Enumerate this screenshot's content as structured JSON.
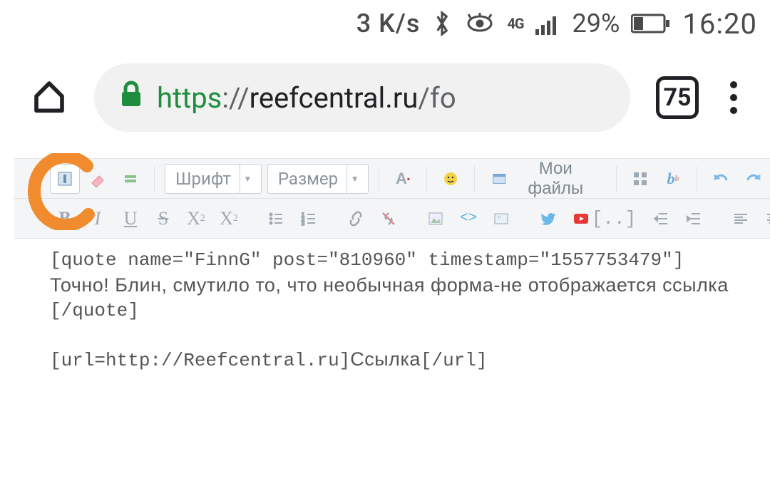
{
  "status": {
    "speed": "3 K/s",
    "battery_pct": "29%",
    "clock": "16:20",
    "net_label": "4G"
  },
  "browser": {
    "proto": "https",
    "sep": "://",
    "host": "reefcentral.ru",
    "path": "/fo",
    "tab_count": "75"
  },
  "toolbar": {
    "font_label": "Шрифт",
    "size_label": "Размер",
    "files_label": "Мои файлы"
  },
  "editor": {
    "l1": "[quote name=\"FinnG\" post=\"810960\" timestamp=\"1557753479\"]",
    "l2": "Точно! Блин, смутило то, что необычная форма-не отображается ссылка",
    "l3": "[/quote]",
    "l4": "",
    "l5a": "[url=http://Reefcentral.ru]",
    "l5b": "Ссылка",
    "l5c": "[/url]"
  }
}
